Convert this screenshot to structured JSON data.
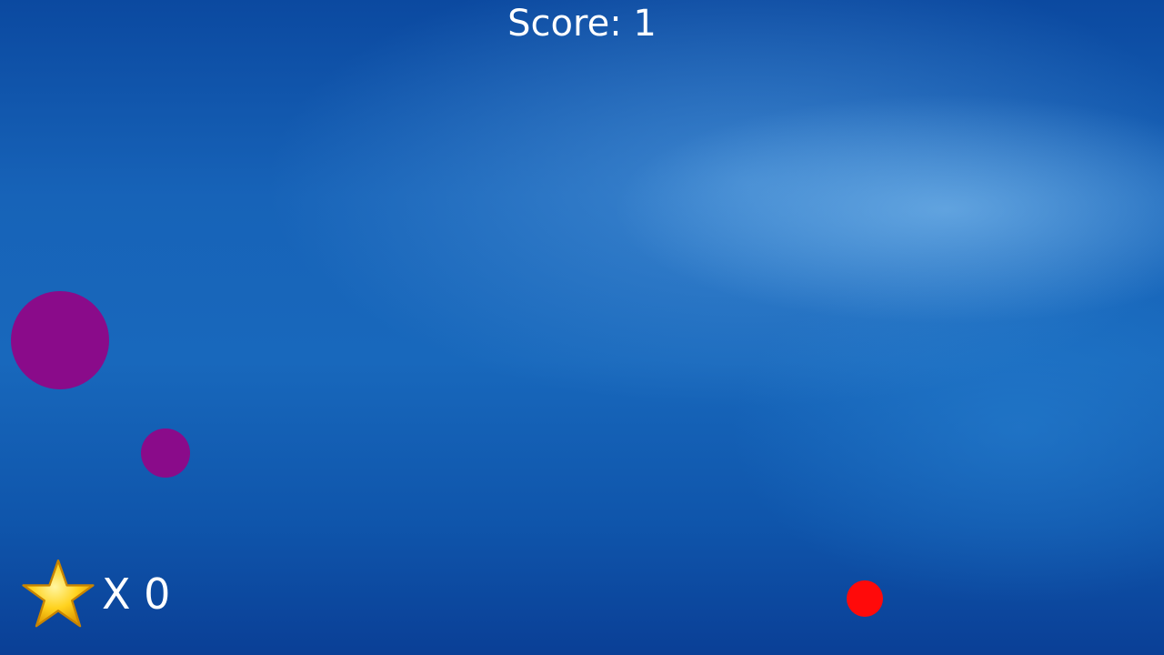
{
  "hud": {
    "score_text": "Score: 1",
    "star_count_text": "X 0"
  },
  "icons": {
    "star": "star-icon"
  },
  "colors": {
    "background": "#1763b8",
    "purple_ball": "#8a0b8a",
    "red_ball": "#ff0a0a",
    "star": "#ffd21e",
    "text": "#ffffff"
  }
}
